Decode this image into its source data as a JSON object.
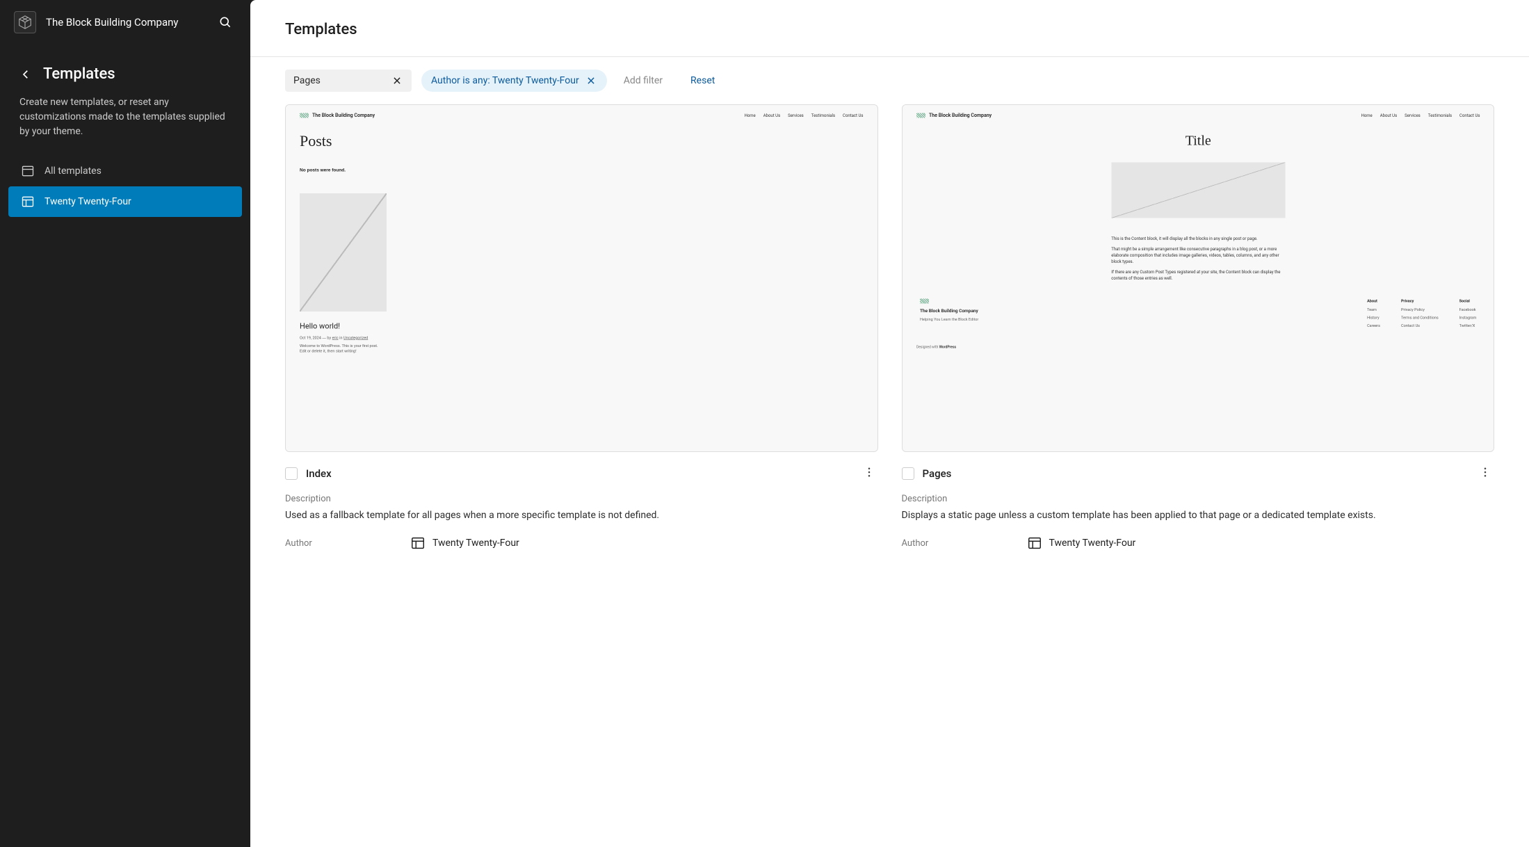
{
  "site": {
    "title": "The Block Building Company"
  },
  "sidebar": {
    "nav_title": "Templates",
    "description": "Create new templates, or reset any customizations made to the templates supplied by your theme.",
    "items": [
      {
        "label": "All templates",
        "active": false
      },
      {
        "label": "Twenty Twenty-Four",
        "active": true
      }
    ]
  },
  "main": {
    "title": "Templates",
    "filters": {
      "search_value": "Pages",
      "author_filter": "Author is any: Twenty Twenty-Four",
      "add_filter": "Add filter",
      "reset": "Reset"
    }
  },
  "labels": {
    "description": "Description",
    "author": "Author"
  },
  "templates": [
    {
      "name": "Index",
      "description": "Used as a fallback template for all pages when a more specific template is not defined.",
      "author": "Twenty Twenty-Four",
      "preview": {
        "site_name": "The Block Building Company",
        "nav": [
          "Home",
          "About Us",
          "Services",
          "Testimonials",
          "Contact Us"
        ],
        "heading": "Posts",
        "no_posts": "No posts were found.",
        "post_title": "Hello world!",
        "post_meta_date": "Oct 19, 2024",
        "post_meta_by": "by",
        "post_meta_author": "eric",
        "post_meta_in": "in",
        "post_meta_cat": "Uncategorized",
        "excerpt": "Welcome to WordPress. This is your first post. Edit or delete it, then start writing!"
      }
    },
    {
      "name": "Pages",
      "description": "Displays a static page unless a custom template has been applied to that page or a dedicated template exists.",
      "author": "Twenty Twenty-Four",
      "preview": {
        "site_name": "The Block Building Company",
        "nav": [
          "Home",
          "About Us",
          "Services",
          "Testimonials",
          "Contact Us"
        ],
        "heading": "Title",
        "p1": "This is the Content block, it will display all the blocks in any single post or page.",
        "p2": "That might be a simple arrangement like consecutive paragraphs in a blog post, or a more elaborate composition that includes image galleries, videos, tables, columns, and any other block types.",
        "p3": "If there are any Custom Post Types registered at your site, the Content block can display the contents of those entries as well.",
        "footer_name": "The Block Building Company",
        "footer_tag": "Helping You Learn the Block Editor",
        "footer_cols": {
          "About": [
            "Team",
            "History",
            "Careers"
          ],
          "Privacy": [
            "Privacy Policy",
            "Terms and Conditions",
            "Contact Us"
          ],
          "Social": [
            "Facebook",
            "Instagram",
            "Twitter/X"
          ]
        },
        "designed_prefix": "Designed with ",
        "designed_link": "WordPress"
      }
    }
  ]
}
